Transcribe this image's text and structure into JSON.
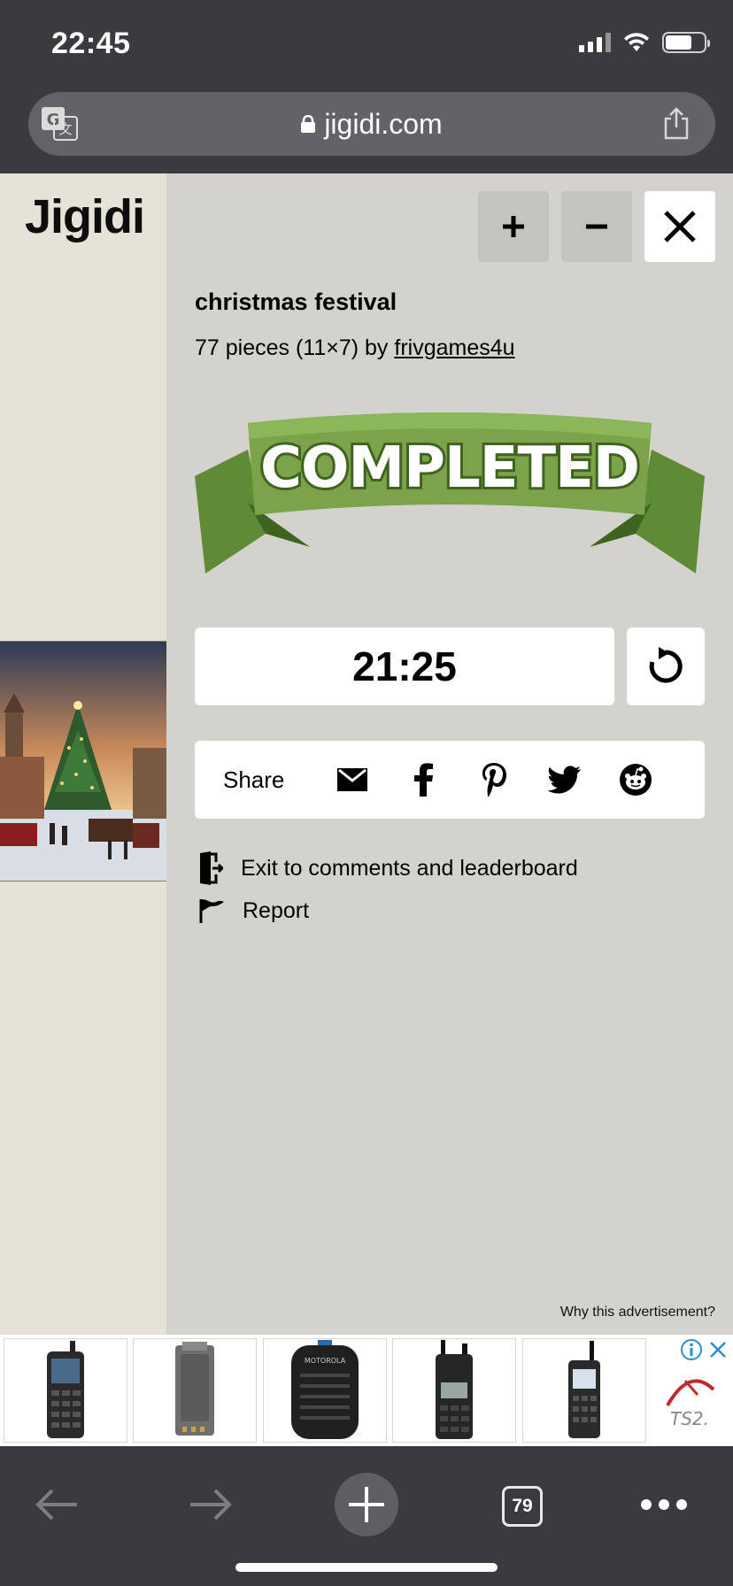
{
  "status_bar": {
    "time": "22:45"
  },
  "browser": {
    "url": "jigidi.com",
    "icons": {
      "translate": "translate-icon",
      "lock": "lock-icon",
      "share": "share-icon"
    }
  },
  "site": {
    "logo": "Jigidi"
  },
  "puzzle": {
    "title": "christmas festival",
    "meta_prefix": "77 pieces (11×7) by",
    "author": "frivgames4u",
    "status_banner": "COMPLETED",
    "timer": "21:25"
  },
  "controls": {
    "zoom_in": "+",
    "zoom_out": "−",
    "close": "✕"
  },
  "share": {
    "label": "Share",
    "targets": [
      "email-icon",
      "facebook-icon",
      "pinterest-icon",
      "twitter-icon",
      "reddit-icon"
    ]
  },
  "links": {
    "exit": "Exit to comments and leaderboard",
    "report": "Report"
  },
  "ad": {
    "why": "Why this advertisement?",
    "brand": "TS2."
  },
  "bottom_bar": {
    "tabs_count": "79"
  },
  "colors": {
    "banner_green": "#7aa34a",
    "banner_dark": "#3f6420",
    "chrome": "#3a3b3f",
    "panel": "#d3d2cd"
  }
}
